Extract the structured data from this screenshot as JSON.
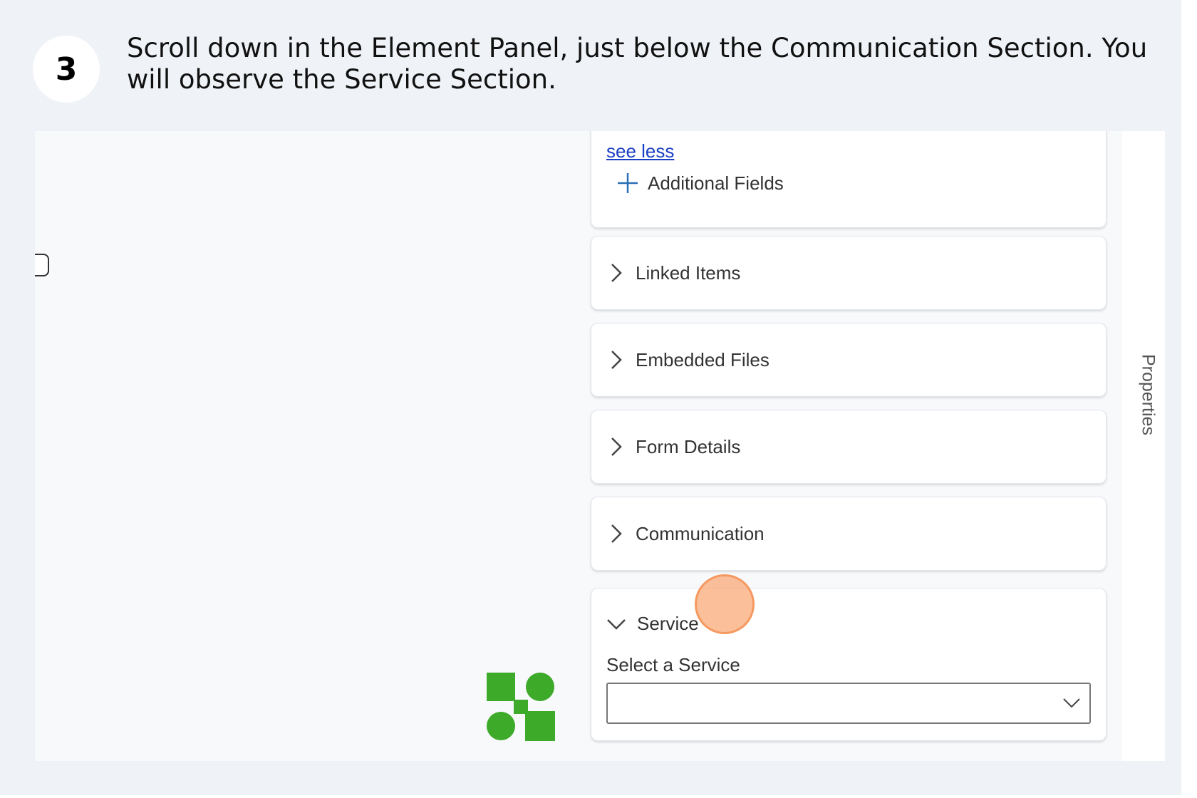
{
  "step": {
    "number": "3",
    "instruction": "Scroll down in the Element Panel, just below the Communication Section. You will observe the Service Section."
  },
  "panel": {
    "see_less": "see less",
    "additional_fields": "Additional Fields",
    "sections": [
      {
        "label": "Linked Items",
        "state": "collapsed"
      },
      {
        "label": "Embedded Files",
        "state": "collapsed"
      },
      {
        "label": "Form Details",
        "state": "collapsed"
      },
      {
        "label": "Communication",
        "state": "collapsed"
      }
    ],
    "service": {
      "label": "Service",
      "state": "expanded",
      "select_label": "Select a Service",
      "select_value": ""
    }
  },
  "sidebar": {
    "properties_label": "Properties"
  },
  "colors": {
    "link": "#1a3fc4",
    "logo_green": "#3daa29",
    "click_marker": "#f7a26e"
  }
}
